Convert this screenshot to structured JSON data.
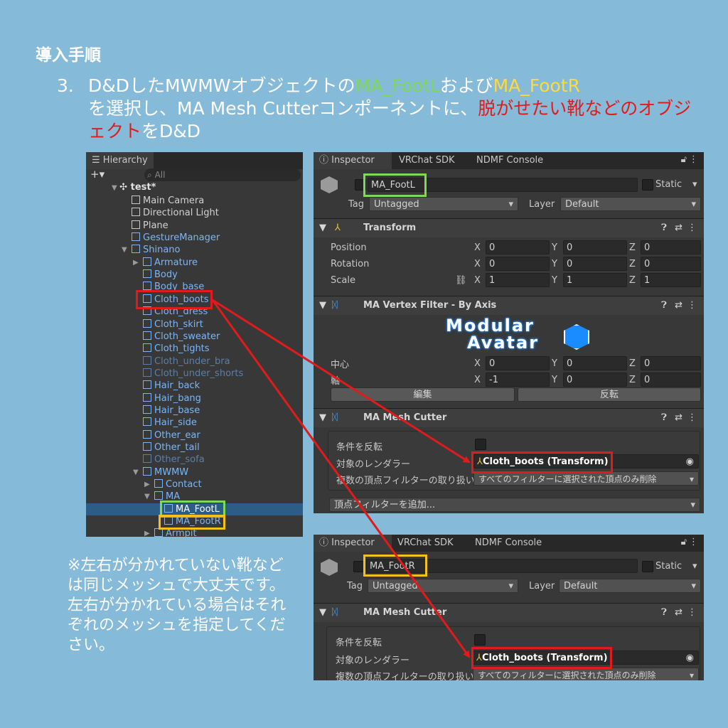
{
  "heading": "導入手順",
  "step": {
    "number": "3.",
    "part1": "D&DしたMWMWオブジェクトの",
    "foot_l": "MA_FootL",
    "part2": "および",
    "foot_r": "MA_FootR",
    "part3": "を選択し、MA Mesh Cutterコンポーネントに、",
    "emphasis": "脱がせたい靴などのオブジェクト",
    "part4": "をD&D"
  },
  "note": {
    "line1": "※左右が分かれていない靴などは同じメッシュで大丈夫です。",
    "line2": "左右が分かれている場合はそれぞれのメッシュを指定してください。"
  },
  "hierarchy": {
    "tab": "Hierarchy",
    "add": "+▾",
    "search_placeholder": "All",
    "scene": "test*",
    "items": [
      {
        "label": "Main Camera",
        "state": "normal",
        "depth": 1
      },
      {
        "label": "Directional Light",
        "state": "normal",
        "depth": 1
      },
      {
        "label": "Plane",
        "state": "normal",
        "depth": 1
      },
      {
        "label": "GestureManager",
        "state": "prefab",
        "depth": 1
      },
      {
        "label": "Shinano",
        "state": "prefab",
        "depth": 1,
        "expanded": true
      },
      {
        "label": "Armature",
        "state": "prefab",
        "depth": 2,
        "collapsed": true
      },
      {
        "label": "Body",
        "state": "prefab",
        "depth": 2
      },
      {
        "label": "Body_base",
        "state": "prefab",
        "depth": 2
      },
      {
        "label": "Cloth_boots",
        "state": "prefab",
        "depth": 2
      },
      {
        "label": "Cloth_dress",
        "state": "prefab",
        "depth": 2
      },
      {
        "label": "Cloth_skirt",
        "state": "prefab",
        "depth": 2
      },
      {
        "label": "Cloth_sweater",
        "state": "prefab",
        "depth": 2
      },
      {
        "label": "Cloth_tights",
        "state": "prefab",
        "depth": 2
      },
      {
        "label": "Cloth_under_bra",
        "state": "disabled",
        "depth": 2
      },
      {
        "label": "Cloth_under_shorts",
        "state": "disabled",
        "depth": 2
      },
      {
        "label": "Hair_back",
        "state": "prefab",
        "depth": 2
      },
      {
        "label": "Hair_bang",
        "state": "prefab",
        "depth": 2
      },
      {
        "label": "Hair_base",
        "state": "prefab",
        "depth": 2
      },
      {
        "label": "Hair_side",
        "state": "prefab",
        "depth": 2
      },
      {
        "label": "Other_ear",
        "state": "prefab",
        "depth": 2
      },
      {
        "label": "Other_tail",
        "state": "prefab",
        "depth": 2
      },
      {
        "label": "Other_sofa",
        "state": "disabled",
        "depth": 2
      },
      {
        "label": "MWMW",
        "state": "prefab",
        "depth": 2,
        "expanded": true
      },
      {
        "label": "Contact",
        "state": "prefab",
        "depth": 3,
        "collapsed": true
      },
      {
        "label": "MA",
        "state": "prefab",
        "depth": 3,
        "expanded": true
      },
      {
        "label": "MA_FootL",
        "state": "prefab",
        "depth": 4,
        "selected": true
      },
      {
        "label": "MA_FootR",
        "state": "prefab",
        "depth": 4
      },
      {
        "label": "Armpit",
        "state": "prefab",
        "depth": 3,
        "collapsed": true
      }
    ]
  },
  "inspector1": {
    "tabs": [
      "Inspector",
      "VRChat SDK",
      "NDMF Console"
    ],
    "object_name": "MA_FootL",
    "static_label": "Static",
    "tag_label": "Tag",
    "tag_value": "Untagged",
    "layer_label": "Layer",
    "layer_value": "Default",
    "transform": {
      "title": "Transform",
      "rows": [
        {
          "label": "Position",
          "x": "0",
          "y": "0",
          "z": "0"
        },
        {
          "label": "Rotation",
          "x": "0",
          "y": "0",
          "z": "0"
        },
        {
          "label": "Scale",
          "x": "1",
          "y": "1",
          "z": "1"
        }
      ]
    },
    "vertex_filter": {
      "title": "MA Vertex Filter - By Axis",
      "logo_line1": "Modular",
      "logo_line2": "Avatar",
      "center_label": "中心",
      "center": {
        "x": "0",
        "y": "0",
        "z": "0"
      },
      "axis_label": "軸",
      "axis": {
        "x": "-1",
        "y": "0",
        "z": "0"
      },
      "edit_button": "編集",
      "flip_button": "反転"
    },
    "mesh_cutter": {
      "title": "MA Mesh Cutter",
      "invert_label": "条件を反転",
      "renderer_label": "対象のレンダラー",
      "renderer_value": "Cloth_boots (Transform)",
      "multi_label": "複数の頂点フィルターの取り扱い",
      "multi_value": "すべてのフィルターに選択された頂点のみ削除",
      "add_filter": "頂点フィルターを追加..."
    }
  },
  "inspector2": {
    "tabs": [
      "Inspector",
      "VRChat SDK",
      "NDMF Console"
    ],
    "object_name": "MA_FootR",
    "static_label": "Static",
    "tag_label": "Tag",
    "tag_value": "Untagged",
    "layer_label": "Layer",
    "layer_value": "Default",
    "mesh_cutter": {
      "title": "MA Mesh Cutter",
      "invert_label": "条件を反転",
      "renderer_label": "対象のレンダラー",
      "renderer_value": "Cloth_boots (Transform)",
      "multi_label": "複数の頂点フィルターの取り扱い",
      "multi_value": "すべてのフィルターに選択された頂点のみ削除"
    }
  },
  "colors": {
    "background": "#86bad9",
    "highlight_red": "#e01b1b",
    "highlight_green": "#7ed957",
    "highlight_yellow": "#f2c21a"
  }
}
